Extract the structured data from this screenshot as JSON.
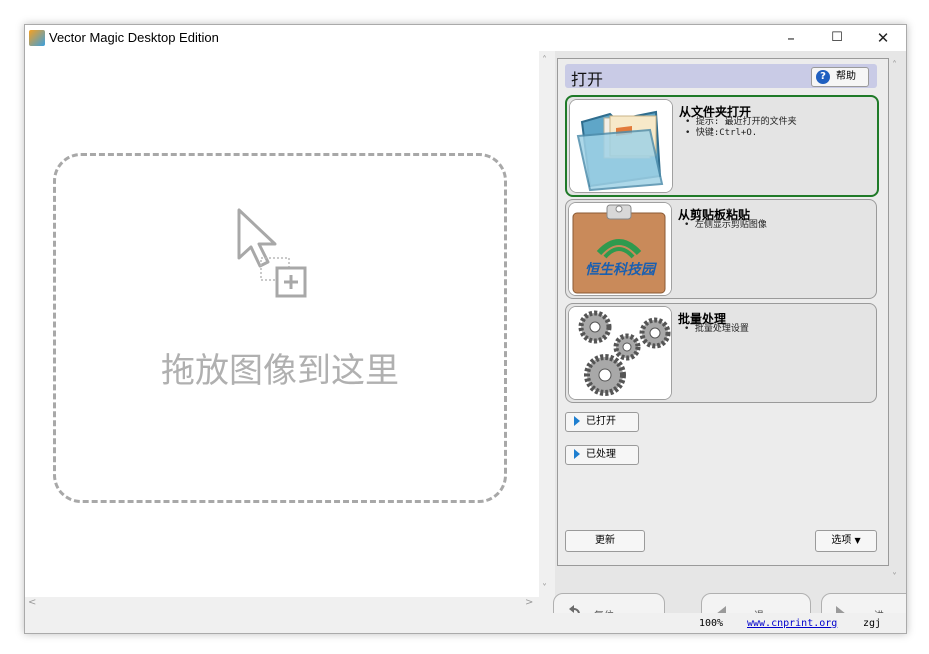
{
  "window": {
    "title": "Vector Magic Desktop Edition",
    "minimize": "–",
    "maximize": "☐",
    "close": "✕"
  },
  "left": {
    "drop_text": "拖放图像到这里"
  },
  "panel": {
    "title": "打开",
    "help_label": "帮助",
    "cards": [
      {
        "title": "从文件夹打开",
        "lines": [
          "• 提示: 最近打开的文件夹",
          "• 快键:Ctrl+O."
        ]
      },
      {
        "title": "从剪贴板粘贴",
        "lines": [
          "• 左侧显示剪贴图像"
        ],
        "thumb_text": "恒生科技园"
      },
      {
        "title": "批量处理",
        "lines": [
          "• 批量处理设置"
        ]
      }
    ],
    "opened_label": "已打开",
    "processed_label": "已处理",
    "update_label": "更新",
    "options_label": "选项"
  },
  "nav": {
    "reset_label": "复位",
    "back_label": "退",
    "forward_label": "进"
  },
  "status": {
    "zoom": "100%",
    "link": "www.cnprint.org",
    "user": "zgj"
  },
  "colors": {
    "selected_border": "#1f7a28",
    "header_bg": "#c9cbe6",
    "link": "#0000cc",
    "expander": "#1e7fd0"
  }
}
